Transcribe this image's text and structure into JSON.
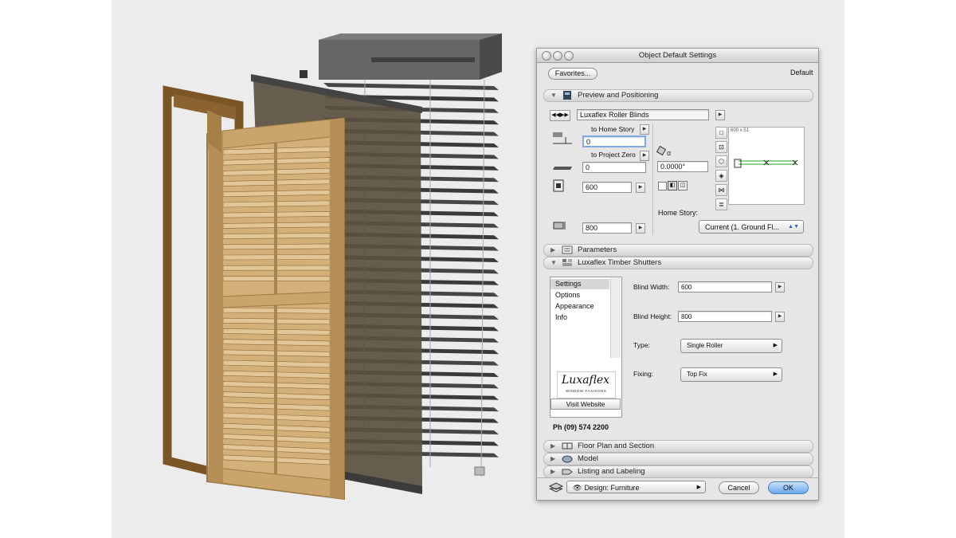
{
  "dialog": {
    "title": "Object Default Settings",
    "favorites_label": "Favorites...",
    "default_label": "Default"
  },
  "preview": {
    "section_label": "Preview and Positioning",
    "object_name": "Luxaflex Roller Blinds",
    "to_home_story_label": "to Home Story",
    "to_home_story_value": "0",
    "to_project_zero_label": "to Project Zero",
    "to_project_zero_value": "0",
    "width_value": "600",
    "height_value": "800",
    "angle_value": "0.0000°",
    "home_story_label": "Home Story:",
    "home_story_value": "Current (1. Ground Fl...",
    "preview_size": "600 x 51"
  },
  "parameters": {
    "section_label": "Parameters"
  },
  "shutters": {
    "section_label": "Luxaflex Timber Shutters",
    "nav_items": [
      "Settings",
      "Options",
      "Appearance",
      "Info"
    ],
    "blind_width_label": "Blind Width:",
    "blind_width_value": "600",
    "blind_height_label": "Blind Height:",
    "blind_height_value": "800",
    "type_label": "Type:",
    "type_value": "Single Roller",
    "fixing_label": "Fixing:",
    "fixing_value": "Top Fix",
    "logo_text": "Luxaflex",
    "logo_subtext": "WINDOW FASHIONS",
    "visit_website": "Visit Website",
    "phone": "Ph (09) 574 2200"
  },
  "collapsed_sections": [
    "Floor Plan and Section",
    "Model",
    "Listing and Labeling"
  ],
  "footer": {
    "design_label": "Design: Furniture",
    "cancel_label": "Cancel",
    "ok_label": "OK"
  },
  "colors": {
    "ok_accent": "#6aa8e8",
    "wood": "#c9a46b",
    "frame": "#7a5525",
    "slat_dark": "#3c3c3c"
  }
}
